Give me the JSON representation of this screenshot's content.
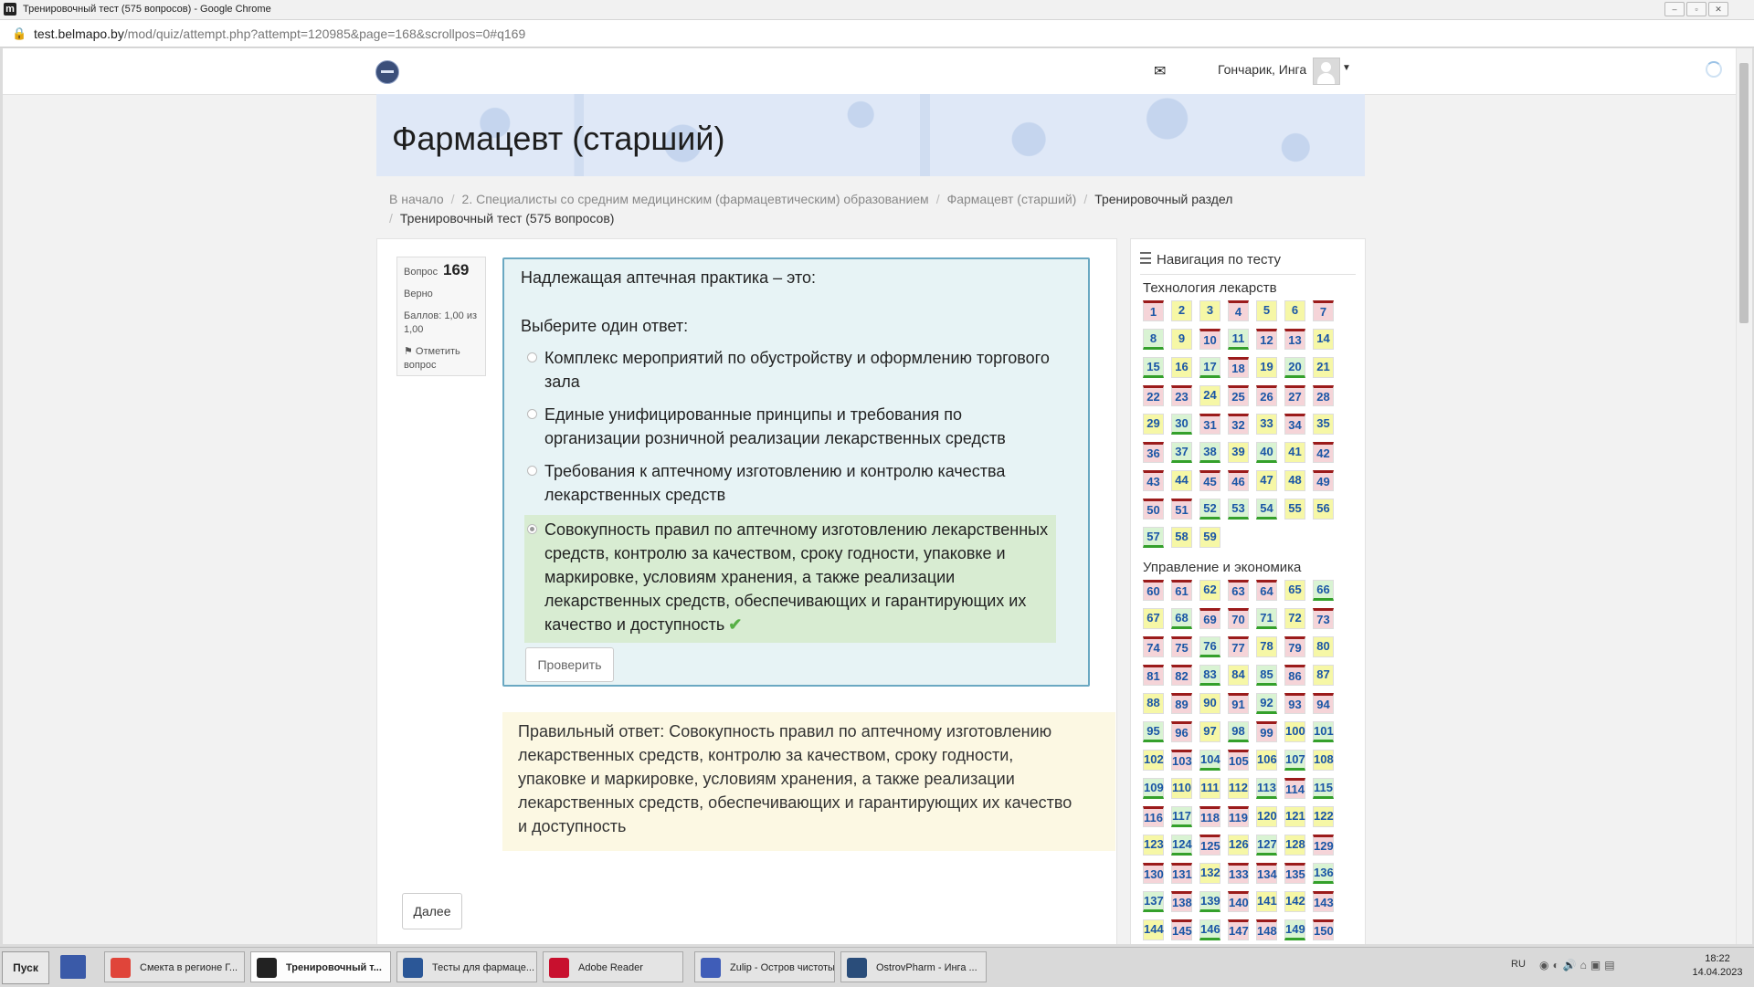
{
  "window": {
    "title": "Тренировочный тест (575 вопросов) - Google Chrome",
    "app_icon": "m",
    "url_host": "test.belmapo.by",
    "url_rest": "/mod/quiz/attempt.php?attempt=120985&page=168&scrollpos=0#q169"
  },
  "navbar": {
    "user_name": "Гончарик, Инга"
  },
  "page_title": "Фармацевт (старший)",
  "breadcrumb": [
    "В начало",
    "2. Специалисты со средним медицинским (фармацевтическим) образованием",
    "Фармацевт (старший)",
    "Тренировочный раздел",
    "Тренировочный тест (575 вопросов)"
  ],
  "question_info": {
    "label": "Вопрос",
    "number": "169",
    "state": "Верно",
    "mark": "Баллов: 1,00 из 1,00",
    "flag_label": "Отметить вопрос"
  },
  "question": {
    "text": "Надлежащая аптечная практика – это:",
    "prompt": "Выберите один ответ:",
    "answers": [
      {
        "text": "Комплекс мероприятий по обустройству и оформлению торгового зала",
        "selected": false
      },
      {
        "text": "Единые унифицированные принципы и требования по организации розничной реализации лекарственных средств",
        "selected": false
      },
      {
        "text": "Требования к аптечному изготовлению и контролю качества лекарственных средств",
        "selected": false
      },
      {
        "text": "Совокупность правил по аптечному изготовлению лекарственных средств, контролю за качеством, сроку годности, упаковке и маркировке, условиям хранения, а также реализации лекарственных средств, обеспечивающих и гарантирующих их качество и доступность",
        "selected": true,
        "correct": true
      }
    ],
    "check_button": "Проверить"
  },
  "feedback": "Правильный ответ: Совокупность правил по аптечному изготовлению лекарственных средств, контролю за качеством, сроку годности, упаковке и маркировке, условиям хранения, а также реализации лекарственных средств, обеспечивающих и гарантирующих их качество и доступность",
  "next_button": "Далее",
  "quiz_nav": {
    "title": "Навигация по тесту",
    "sections": [
      {
        "title": "Технология лекарств",
        "states": "wppwppwcpwcwwpcpcwpcpwwpwwwwpcwwpwpwccpcpwwpwwppwwwcccppcpp"
      },
      {
        "title": "Управление и экономика",
        "states": "wwpwwpcpcwwcpwwwcwpwpwwcpcwppwpwcwwcwpcwpcpwcwpcpcpppcwcwcwwppppcwpcpwwwpwwwccwcwppwpwcwwcwwccpcwwwpwwwcc"
      }
    ]
  },
  "taskbar": {
    "start": "Пуск",
    "tasks": [
      {
        "label": "Смекта в регионе Г...",
        "active": false,
        "color": "#e0453a"
      },
      {
        "label": "Тренировочный т...",
        "active": true,
        "color": "#222222"
      },
      {
        "label": "Тесты для фармаце...",
        "active": false,
        "color": "#2b5797"
      },
      {
        "label": "Adobe Reader",
        "active": false,
        "color": "#c8102e"
      },
      {
        "label": "Zulip - Остров чистоты",
        "active": false,
        "color": "#3f5db8"
      },
      {
        "label": "OstrovPharm - Инга ...",
        "active": false,
        "color": "#2a4d7a"
      }
    ],
    "lang": "RU",
    "time": "18:22",
    "date": "14.04.2023"
  },
  "colors": {
    "correct_bg": "#d9f3d3",
    "wrong_bg": "#f5d4d8",
    "partial_bg": "#f6f7a6",
    "question_box": "#e7f3f5",
    "feedback_bg": "#fcf8e3"
  }
}
